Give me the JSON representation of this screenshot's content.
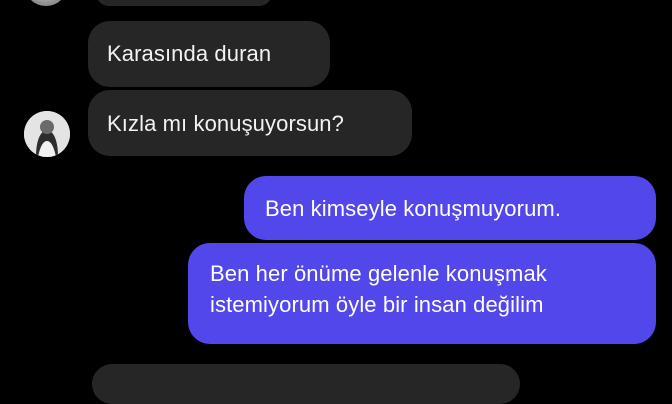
{
  "thread": {
    "incoming": [
      {
        "text": "Karasında duran"
      },
      {
        "text": "Kızla mı konuşuyorsun?"
      }
    ],
    "outgoing": [
      {
        "text": "Ben kimseyle konuşmuyorum."
      },
      {
        "lines": [
          "Ben her önüme gelenle konuşmak",
          "istemiyorum öyle bir insan değilim"
        ]
      }
    ]
  },
  "colors": {
    "background": "#000000",
    "incoming_bubble": "#262626",
    "outgoing_bubble": "#5247eb",
    "text_incoming": "#f2f2f2",
    "text_outgoing": "#ffffff"
  },
  "icons": {
    "contact_avatar": "contact-avatar-photo"
  }
}
